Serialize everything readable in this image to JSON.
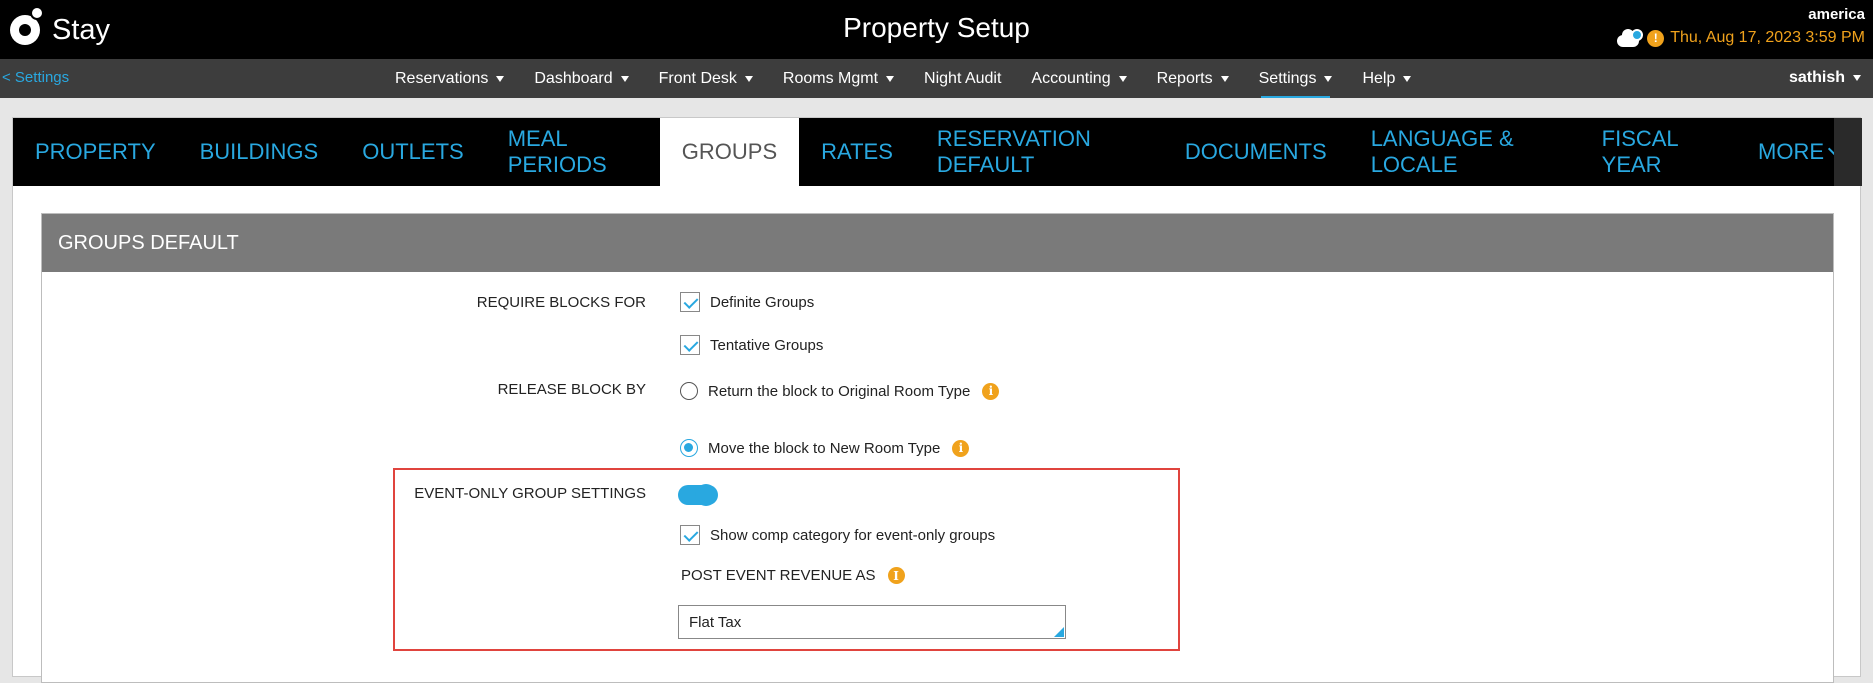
{
  "header": {
    "logo_text": "Stay",
    "title": "Property Setup",
    "region": "america",
    "datetime": "Thu, Aug 17, 2023 3:59 PM",
    "alert_glyph": "!"
  },
  "navbar": {
    "back_label": "<  Settings",
    "items": [
      {
        "label": "Reservations"
      },
      {
        "label": "Dashboard"
      },
      {
        "label": "Front Desk"
      },
      {
        "label": "Rooms Mgmt"
      },
      {
        "label": "Night Audit"
      },
      {
        "label": "Accounting"
      },
      {
        "label": "Reports"
      },
      {
        "label": "Settings"
      },
      {
        "label": "Help"
      }
    ],
    "user": "sathish"
  },
  "tabs": [
    {
      "label": "PROPERTY"
    },
    {
      "label": "BUILDINGS"
    },
    {
      "label": "OUTLETS"
    },
    {
      "label": "MEAL PERIODS"
    },
    {
      "label": "GROUPS"
    },
    {
      "label": "RATES"
    },
    {
      "label": "RESERVATION DEFAULT"
    },
    {
      "label": "DOCUMENTS"
    },
    {
      "label": "LANGUAGE & LOCALE"
    },
    {
      "label": "FISCAL YEAR"
    },
    {
      "label": "MORE"
    }
  ],
  "panel": {
    "title": "GROUPS DEFAULT",
    "require_blocks": {
      "label": "REQUIRE BLOCKS FOR",
      "option1": "Definite Groups",
      "option2": "Tentative Groups"
    },
    "release_block": {
      "label": "RELEASE BLOCK BY",
      "option1": "Return the block to Original Room Type",
      "option2": "Move the block to New Room Type"
    },
    "event_only": {
      "label": "EVENT-ONLY GROUP SETTINGS",
      "show_comp": "Show comp category for event-only groups",
      "post_label": "POST EVENT REVENUE AS",
      "post_value": "Flat Tax"
    },
    "info_glyph": "i"
  },
  "colors": {
    "accent": "#29a8e0",
    "warning": "#f0a21c",
    "highlight": "#e0443e",
    "panel_header": "#7a7a7a"
  }
}
